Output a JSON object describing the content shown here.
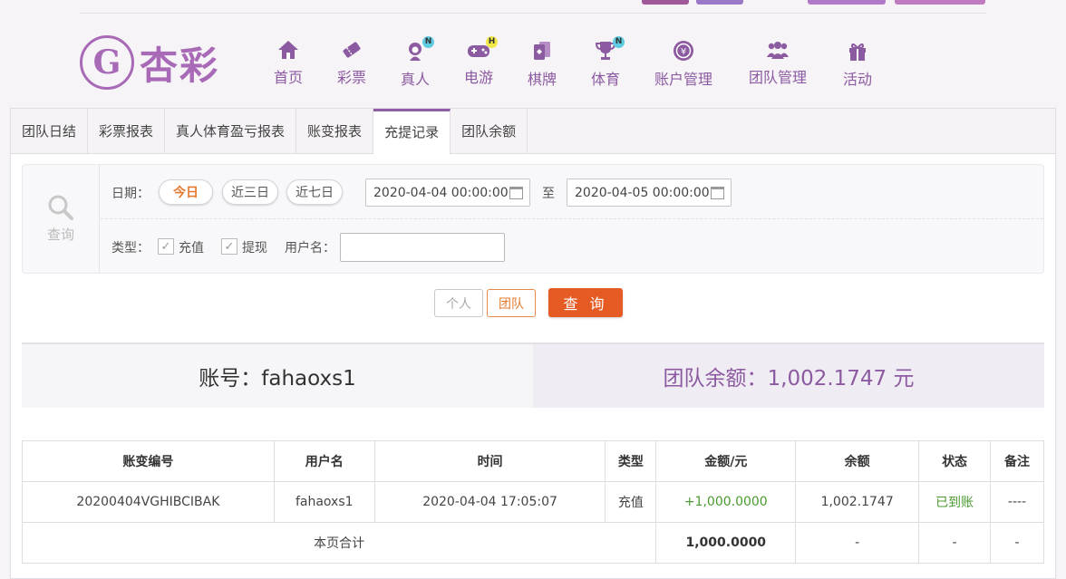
{
  "brand": {
    "name": "杏彩",
    "accent": "#8c5aa1",
    "orange": "#e65a24"
  },
  "nav": [
    {
      "label": "首页",
      "icon": "home-icon",
      "badge": ""
    },
    {
      "label": "彩票",
      "icon": "lottery-ticket-icon",
      "badge": ""
    },
    {
      "label": "真人",
      "icon": "live-dealer-icon",
      "badge": "N"
    },
    {
      "label": "电游",
      "icon": "gamepad-icon",
      "badge": "H"
    },
    {
      "label": "棋牌",
      "icon": "playing-cards-icon",
      "badge": ""
    },
    {
      "label": "体育",
      "icon": "trophy-icon",
      "badge": "N"
    },
    {
      "label": "账户管理",
      "icon": "account-coin-icon",
      "badge": ""
    },
    {
      "label": "团队管理",
      "icon": "team-users-icon",
      "badge": ""
    },
    {
      "label": "活动",
      "icon": "gift-icon",
      "badge": ""
    }
  ],
  "tabs": [
    {
      "label": "团队日结"
    },
    {
      "label": "彩票报表"
    },
    {
      "label": "真人体育盈亏报表"
    },
    {
      "label": "账变报表"
    },
    {
      "label": "充提记录"
    },
    {
      "label": "团队余额"
    }
  ],
  "active_tab": "充提记录",
  "query": {
    "side_label": "查询",
    "date_label": "日期：",
    "date_presets": [
      "今日",
      "近三日",
      "近七日"
    ],
    "start": "2020-04-04 00:00:00",
    "to_label": "至",
    "end": "2020-04-05 00:00:00",
    "type_label": "类型：",
    "types": [
      "充值",
      "提现"
    ],
    "username_label": "用户名：",
    "username_value": ""
  },
  "buttons": {
    "personal": "个人",
    "team": "团队",
    "search": "查 询"
  },
  "summary": {
    "account": "账号：fahaoxs1",
    "team_balance": "团队余额：1,002.1747 元"
  },
  "table": {
    "headers": [
      "账变编号",
      "用户名",
      "时间",
      "类型",
      "金额/元",
      "余额",
      "状态",
      "备注"
    ],
    "rows": [
      [
        "20200404VGHIBCIBAK",
        "fahaoxs1",
        "2020-04-04 17:05:07",
        "充值",
        "+1,000.0000",
        "1,002.1747",
        "已到账",
        "----"
      ]
    ],
    "footer": {
      "label": "本页合计",
      "amount": "1,000.0000",
      "balance": "-",
      "status": "-",
      "note": "-"
    }
  }
}
